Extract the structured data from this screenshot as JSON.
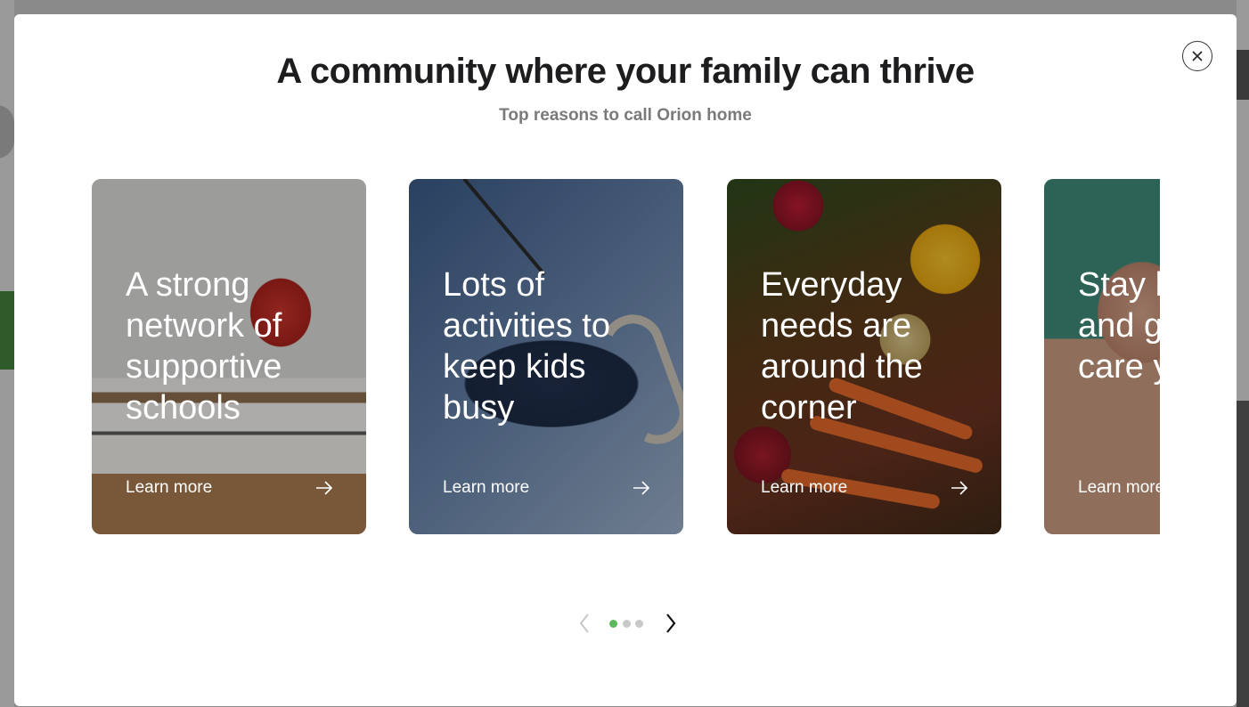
{
  "modal": {
    "title": "A community where your family can thrive",
    "subtitle": "Top reasons to call Orion home",
    "close_icon": "close-icon"
  },
  "cards": [
    {
      "title": "A strong network of supportive schools",
      "link": "Learn more"
    },
    {
      "title": "Lots of activities to keep kids busy",
      "link": "Learn more"
    },
    {
      "title": "Everyday needs are around the corner",
      "link": "Learn more"
    },
    {
      "title": "Stay healthy and get the care you need",
      "link": "Learn more"
    }
  ],
  "pager": {
    "dots": 3,
    "active_index": 0,
    "active_color": "#5cb85c",
    "inactive_color": "#c8c8c8"
  }
}
